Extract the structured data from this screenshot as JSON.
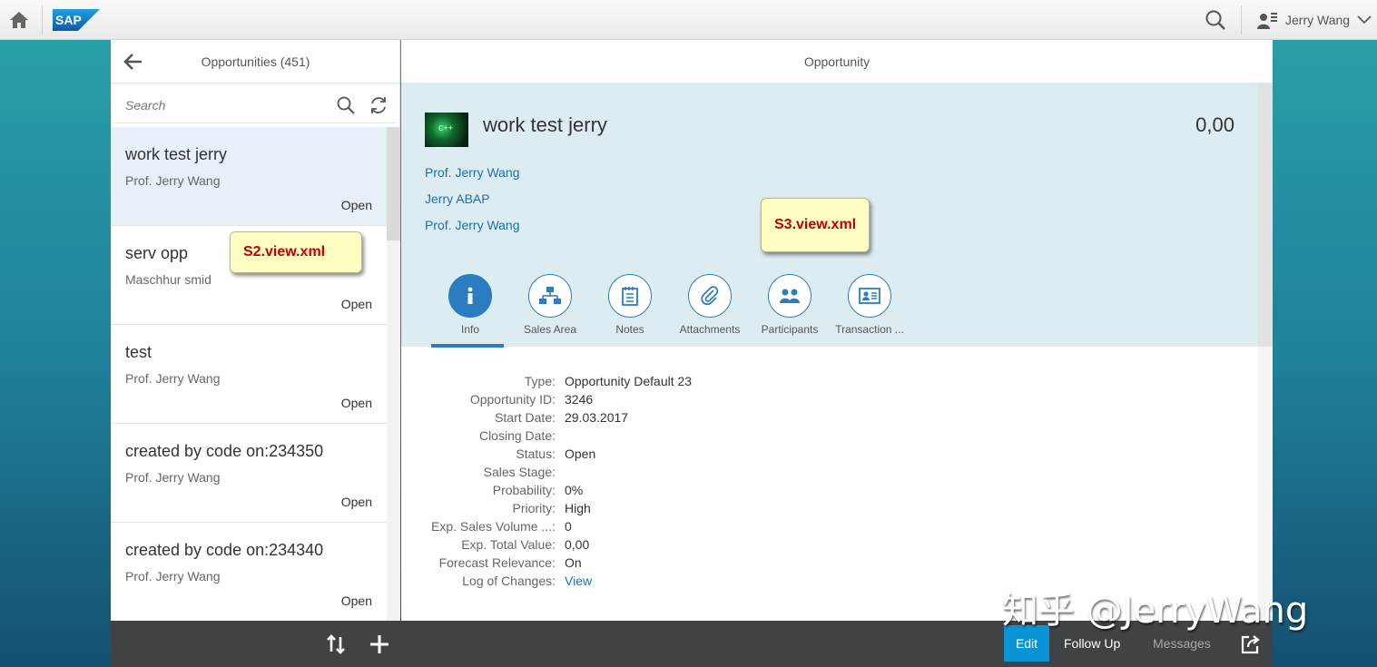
{
  "shell": {
    "logo_text": "SAP",
    "user_name": "Jerry Wang"
  },
  "master": {
    "title": "Opportunities (451)",
    "search_placeholder": "Search",
    "items": [
      {
        "title": "work test jerry",
        "subtitle": "Prof. Jerry Wang",
        "status": "Open"
      },
      {
        "title": "serv opp",
        "subtitle": "Maschhur smid",
        "status": "Open"
      },
      {
        "title": "test",
        "subtitle": "Prof. Jerry Wang",
        "status": "Open"
      },
      {
        "title": "created by code on:234350",
        "subtitle": "Prof. Jerry Wang",
        "status": "Open"
      },
      {
        "title": "created by code on:234340",
        "subtitle": "Prof. Jerry Wang",
        "status": "Open"
      }
    ]
  },
  "detail": {
    "title": "Opportunity",
    "object_title": "work test jerry",
    "object_number": "0,00",
    "thumb_text": "C++",
    "attributes": [
      "Prof. Jerry Wang",
      "Jerry ABAP",
      "Prof. Jerry Wang"
    ],
    "tabs": [
      {
        "label": "Info",
        "icon": "info-icon"
      },
      {
        "label": "Sales Area",
        "icon": "hierarchy-icon"
      },
      {
        "label": "Notes",
        "icon": "notes-icon"
      },
      {
        "label": "Attachments",
        "icon": "paperclip-icon"
      },
      {
        "label": "Participants",
        "icon": "group-icon"
      },
      {
        "label": "Transaction ...",
        "icon": "business-card-icon"
      }
    ],
    "fields": [
      {
        "label": "Type:",
        "value": "Opportunity Default 23"
      },
      {
        "label": "Opportunity ID:",
        "value": "3246"
      },
      {
        "label": "Start Date:",
        "value": "29.03.2017"
      },
      {
        "label": "Closing Date:",
        "value": ""
      },
      {
        "label": "Status:",
        "value": "Open"
      },
      {
        "label": "Sales Stage:",
        "value": ""
      },
      {
        "label": "Probability:",
        "value": "0%"
      },
      {
        "label": "Priority:",
        "value": "High"
      },
      {
        "label": "Exp. Sales Volume ...:",
        "value": "0"
      },
      {
        "label": "Exp. Total Value:",
        "value": "0,00"
      },
      {
        "label": "Forecast Relevance:",
        "value": "On"
      },
      {
        "label": "Log of Changes:",
        "value": "View"
      }
    ]
  },
  "notes": {
    "s2": "S2.view.xml",
    "s3": "S3.view.xml"
  },
  "footer": {
    "edit": "Edit",
    "follow_up": "Follow Up",
    "messages": "Messages"
  },
  "watermark": "知乎 @JerryWang",
  "colors": {
    "accent": "#2b7dbf",
    "selection": "#e5f0f7",
    "header_bg": "#dcecf1",
    "footer_bg": "#3f4346",
    "edit_button": "#0a94d6",
    "note_text": "#c00000"
  }
}
